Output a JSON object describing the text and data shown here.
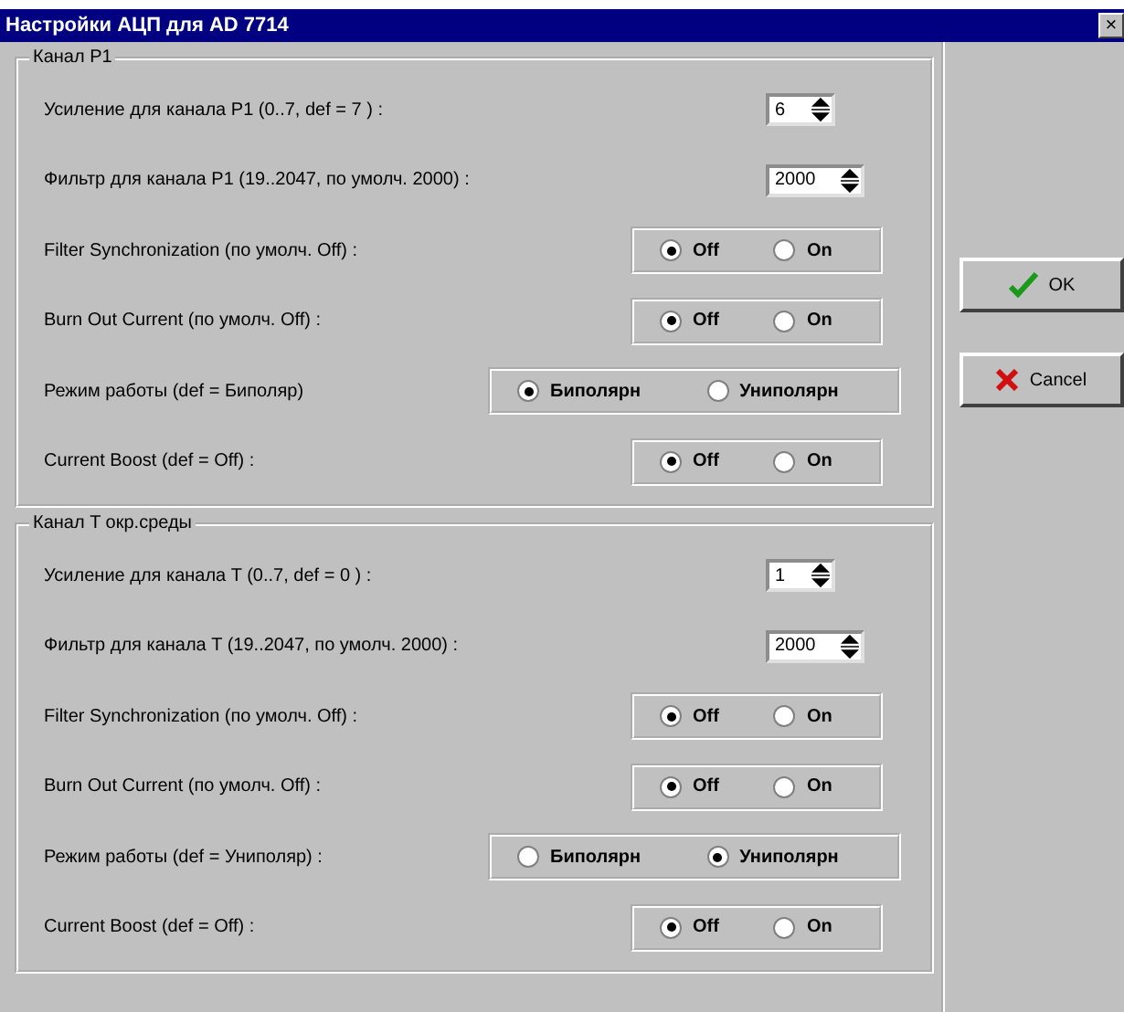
{
  "window": {
    "title": "Настройки АЦП для AD 7714",
    "close": "×"
  },
  "groups": [
    {
      "title": "Канал P1",
      "rows": [
        {
          "kind": "spin",
          "label": "Усиление для канала P1 (0..7, def = 7 ) :",
          "value": "6"
        },
        {
          "kind": "spin",
          "label": "Фильтр для канала P1 (19..2047, по умолч. 2000) :",
          "value": "2000"
        },
        {
          "kind": "radio",
          "label": "Filter Synchronization (по умолч. Off) :",
          "options": [
            {
              "label": "Off",
              "selected": true
            },
            {
              "label": "On",
              "selected": false
            }
          ]
        },
        {
          "kind": "radio",
          "label": "Burn Out Current (по умолч. Off) :",
          "options": [
            {
              "label": "Off",
              "selected": true
            },
            {
              "label": "On",
              "selected": false
            }
          ]
        },
        {
          "kind": "mode",
          "label": "Режим работы (def = Биполяр)",
          "options": [
            {
              "label": "Биполярн",
              "selected": true
            },
            {
              "label": "Униполярн",
              "selected": false
            }
          ]
        },
        {
          "kind": "radio",
          "label": "Current Boost (def = Off) :",
          "options": [
            {
              "label": "Off",
              "selected": true
            },
            {
              "label": "On",
              "selected": false
            }
          ]
        }
      ]
    },
    {
      "title": "Канал T окр.среды",
      "rows": [
        {
          "kind": "spin",
          "label": "Усиление для канала T (0..7, def = 0 ) :",
          "value": "1"
        },
        {
          "kind": "spin",
          "label": "Фильтр для канала T (19..2047, по умолч. 2000) :",
          "value": "2000"
        },
        {
          "kind": "radio",
          "label": "Filter Synchronization (по умолч. Off) :",
          "options": [
            {
              "label": "Off",
              "selected": true
            },
            {
              "label": "On",
              "selected": false
            }
          ]
        },
        {
          "kind": "radio",
          "label": "Burn Out Current (по умолч. Off) :",
          "options": [
            {
              "label": "Off",
              "selected": true
            },
            {
              "label": "On",
              "selected": false
            }
          ]
        },
        {
          "kind": "mode",
          "label": "Режим работы (def = Униполяр) :",
          "options": [
            {
              "label": "Биполярн",
              "selected": false
            },
            {
              "label": "Униполярн",
              "selected": true
            }
          ]
        },
        {
          "kind": "radio",
          "label": "Current Boost (def = Off) :",
          "options": [
            {
              "label": "Off",
              "selected": true
            },
            {
              "label": "On",
              "selected": false
            }
          ]
        }
      ]
    }
  ],
  "buttons": [
    {
      "kind": "ok",
      "label": "OK"
    },
    {
      "kind": "cancel",
      "label": "Cancel"
    }
  ]
}
